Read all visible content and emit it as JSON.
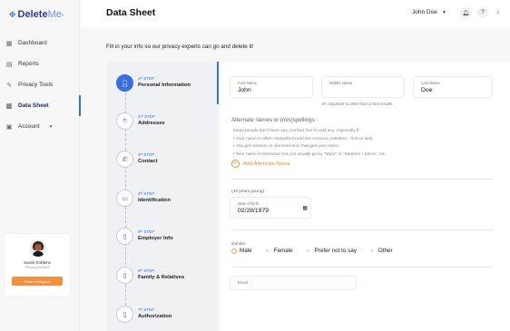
{
  "brand": {
    "logo_mark": "✥",
    "name_bold": "Delete",
    "name_light": "Me",
    "reg": "®"
  },
  "sidebar": {
    "items": [
      {
        "label": "Dashboard",
        "icon": "grid-icon"
      },
      {
        "label": "Reports",
        "icon": "document-icon"
      },
      {
        "label": "Privacy Tools",
        "icon": "tools-icon"
      },
      {
        "label": "Data Sheet",
        "icon": "datasheet-icon",
        "active": true
      },
      {
        "label": "Account",
        "icon": "account-icon",
        "has_submenu": true
      }
    ],
    "advisor": {
      "name": "Sarah Robbins",
      "role": "Privacy Advisor",
      "button": "Make a Request"
    }
  },
  "header": {
    "title": "Data Sheet",
    "user": "John Doe"
  },
  "main": {
    "intro": "Fill in your info so our privacy experts can go and delete it!",
    "steps": [
      {
        "num": "1ˢᵗ STEP",
        "name": "Personal Information",
        "icon": "user-icon",
        "active": true
      },
      {
        "num": "2ⁿᵈ STEP",
        "name": "Addresses",
        "icon": "location-pin-icon"
      },
      {
        "num": "3ʳᵈ STEP",
        "name": "Contact",
        "icon": "phone-icon"
      },
      {
        "num": "4ᵗʰ STEP",
        "name": "Identification",
        "icon": "id-card-icon"
      },
      {
        "num": "5ᵗʰ STEP",
        "name": "Employer Info",
        "icon": "document-icon"
      },
      {
        "num": "6ᵗʰ STEP",
        "name": "Family & Relatives",
        "icon": "document-icon"
      },
      {
        "num": "7ᵗʰ STEP",
        "name": "Authorization",
        "icon": "document-icon"
      }
    ],
    "form": {
      "first_name": {
        "label": "First Name",
        "value": "John"
      },
      "middle_name": {
        "label": "Middle Name",
        "value": "",
        "hint": "It's important to enter this for best results"
      },
      "last_name": {
        "label": "Last Name",
        "value": "Doe"
      },
      "alt_names": {
        "title": "Alternate names or (mis)spellings",
        "desc": "Many people don't have any, but feel free to add any, especially if:",
        "bullets": [
          "Your name is often misspelled (add the common mistakes - first or last)",
          "You got married, or divorced and changed your name.",
          "Your name is Marianne but you usually go by \"Mary\" or \"Stephen / Steve\", etc."
        ],
        "add_label": "Add Alternate Name"
      },
      "age": "(44 years young)",
      "dob": {
        "label": "Date of birth",
        "value": "02/28/1979"
      },
      "gender": {
        "label": "Gender",
        "options": [
          "Male",
          "Female",
          "Prefer not to say",
          "Other"
        ]
      },
      "email": {
        "label": "Email",
        "value": ""
      }
    }
  }
}
